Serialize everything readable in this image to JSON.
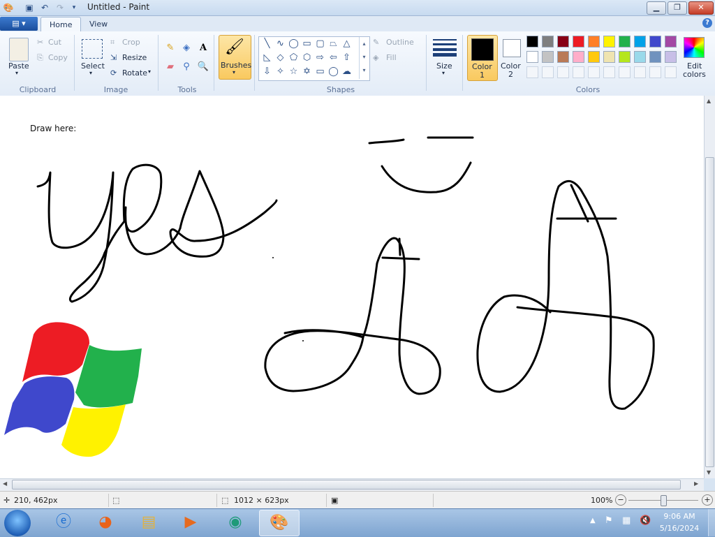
{
  "window": {
    "title": "Untitled - Paint"
  },
  "tabs": [
    {
      "label": "Home"
    },
    {
      "label": "View"
    }
  ],
  "clipboard": {
    "paste": "Paste",
    "cut": "Cut",
    "copy": "Copy",
    "label": "Clipboard"
  },
  "image": {
    "select": "Select",
    "crop": "Crop",
    "resize": "Resize",
    "rotate": "Rotate",
    "label": "Image"
  },
  "tools": {
    "label": "Tools"
  },
  "brushes": {
    "label": "Brushes"
  },
  "shapes": {
    "outline": "Outline",
    "fill": "Fill",
    "label": "Shapes"
  },
  "size": {
    "label": "Size"
  },
  "colors": {
    "color1_line1": "Color",
    "color1_line2": "1",
    "color2_line1": "Color",
    "color2_line2": "2",
    "edit_line1": "Edit",
    "edit_line2": "colors",
    "label": "Colors",
    "color1_value": "#000000",
    "color2_value": "#ffffff",
    "row1": [
      "#000000",
      "#7f7f7f",
      "#880015",
      "#ed1c24",
      "#ff7f27",
      "#fff200",
      "#22b14c",
      "#00a2e8",
      "#3f48cc",
      "#a349a4"
    ],
    "row2": [
      "#ffffff",
      "#c3c3c3",
      "#b97a57",
      "#ffaec9",
      "#ffc90e",
      "#efe4b0",
      "#b5e61d",
      "#99d9ea",
      "#7092be",
      "#c8bfe7"
    ]
  },
  "canvas": {
    "text": "Draw here:"
  },
  "status": {
    "cursor_pos": "210, 462px",
    "canvas_size": "1012 × 623px",
    "zoom": "100%"
  },
  "clock": {
    "time": "9:06 AM",
    "date": "5/16/2024"
  }
}
